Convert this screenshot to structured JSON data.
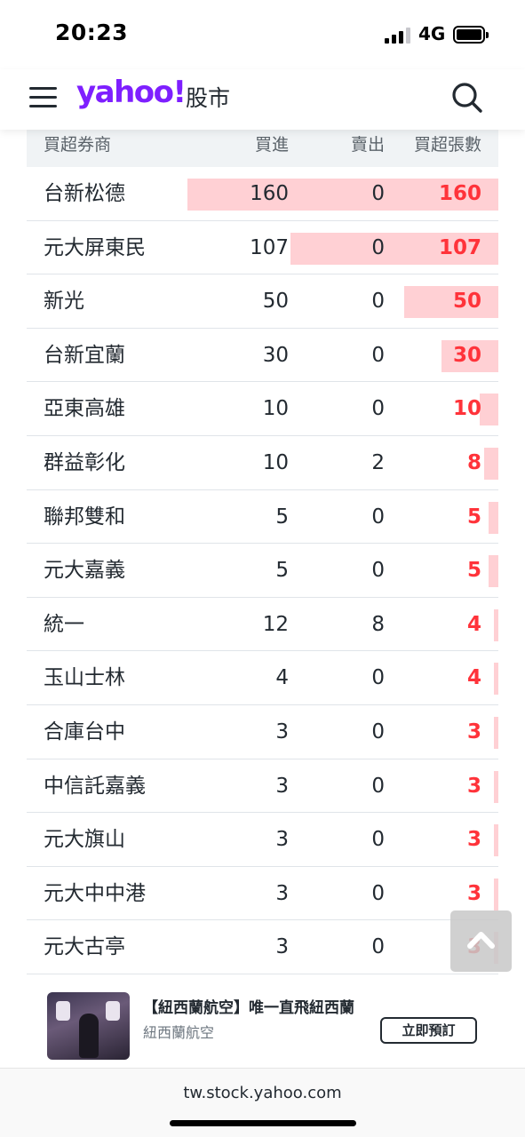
{
  "status_bar": {
    "time": "20:23",
    "network": "4G"
  },
  "header": {
    "logo": "yahoo!",
    "section": "股市"
  },
  "table": {
    "headers": [
      "買超券商",
      "買進",
      "賣出",
      "買超張數"
    ],
    "rows": [
      {
        "broker": "台新松德",
        "buy": "160",
        "sell": "0",
        "net": "160",
        "ratio": 0.66
      },
      {
        "broker": "元大屏東民",
        "buy": "107",
        "sell": "0",
        "net": "107",
        "ratio": 0.44
      },
      {
        "broker": "新光",
        "buy": "50",
        "sell": "0",
        "net": "50",
        "ratio": 0.2
      },
      {
        "broker": "台新宜蘭",
        "buy": "30",
        "sell": "0",
        "net": "30",
        "ratio": 0.12
      },
      {
        "broker": "亞東高雄",
        "buy": "10",
        "sell": "0",
        "net": "10",
        "ratio": 0.04
      },
      {
        "broker": "群益彰化",
        "buy": "10",
        "sell": "2",
        "net": "8",
        "ratio": 0.03
      },
      {
        "broker": "聯邦雙和",
        "buy": "5",
        "sell": "0",
        "net": "5",
        "ratio": 0.02
      },
      {
        "broker": "元大嘉義",
        "buy": "5",
        "sell": "0",
        "net": "5",
        "ratio": 0.02
      },
      {
        "broker": "統一",
        "buy": "12",
        "sell": "8",
        "net": "4",
        "ratio": 0.01
      },
      {
        "broker": "玉山士林",
        "buy": "4",
        "sell": "0",
        "net": "4",
        "ratio": 0.01
      },
      {
        "broker": "合庫台中",
        "buy": "3",
        "sell": "0",
        "net": "3",
        "ratio": 0.01
      },
      {
        "broker": "中信託嘉義",
        "buy": "3",
        "sell": "0",
        "net": "3",
        "ratio": 0.01
      },
      {
        "broker": "元大旗山",
        "buy": "3",
        "sell": "0",
        "net": "3",
        "ratio": 0.01
      },
      {
        "broker": "元大中中港",
        "buy": "3",
        "sell": "0",
        "net": "3",
        "ratio": 0.01
      },
      {
        "broker": "元大古亭",
        "buy": "3",
        "sell": "0",
        "net": "3",
        "ratio": 0.01
      }
    ]
  },
  "ad": {
    "title": "【紐西蘭航空】唯一直飛紐西蘭",
    "brand": "紐西蘭航空",
    "cta": "立即預訂"
  },
  "url_bar": {
    "url": "tw.stock.yahoo.com"
  },
  "colors": {
    "brand": "#7e1fff",
    "net_red": "#ff333a",
    "bar_pink": "#ffd0d4",
    "header_bg": "#f0f3f5"
  },
  "icons": [
    "hamburger-icon",
    "search-icon",
    "chevron-up-icon",
    "signal-icon",
    "battery-icon"
  ]
}
